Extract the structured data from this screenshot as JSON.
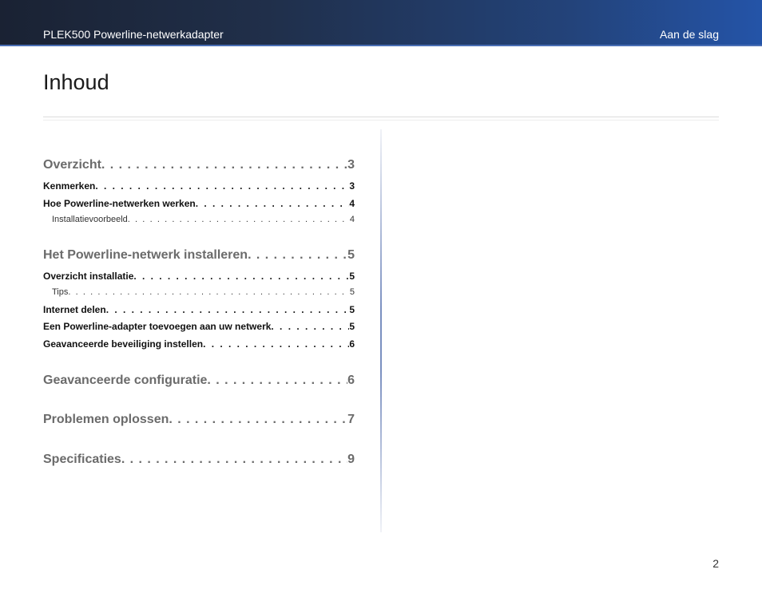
{
  "header": {
    "doc_title": "PLEK500 Powerline-netwerkadapter",
    "section_name": "Aan de slag"
  },
  "page_heading": "Inhoud",
  "toc": {
    "entries": [
      {
        "level": 1,
        "text": "Overzicht",
        "page": "3"
      },
      {
        "level": 2,
        "text": "Kenmerken",
        "page": "3"
      },
      {
        "level": 2,
        "text": "Hoe Powerline-netwerken werken",
        "page": "4"
      },
      {
        "level": 3,
        "text": "Installatievoorbeeld",
        "page": "4"
      },
      {
        "level": 1,
        "text": "Het Powerline-netwerk installeren",
        "page": "5"
      },
      {
        "level": 2,
        "text": "Overzicht installatie",
        "page": "5"
      },
      {
        "level": 3,
        "text": "Tips",
        "page": "5"
      },
      {
        "level": 2,
        "text": "Internet delen",
        "page": "5"
      },
      {
        "level": 2,
        "text": "Een Powerline-adapter toevoegen aan uw netwerk",
        "page": "5"
      },
      {
        "level": 2,
        "text": "Geavanceerde beveiliging instellen",
        "page": "6"
      },
      {
        "level": 1,
        "text": "Geavanceerde configuratie",
        "page": "6"
      },
      {
        "level": 1,
        "text": "Problemen oplossen",
        "page": "7"
      },
      {
        "level": 1,
        "text": "Specificaties",
        "page": "9"
      }
    ]
  },
  "footer": {
    "page_number": "2"
  }
}
